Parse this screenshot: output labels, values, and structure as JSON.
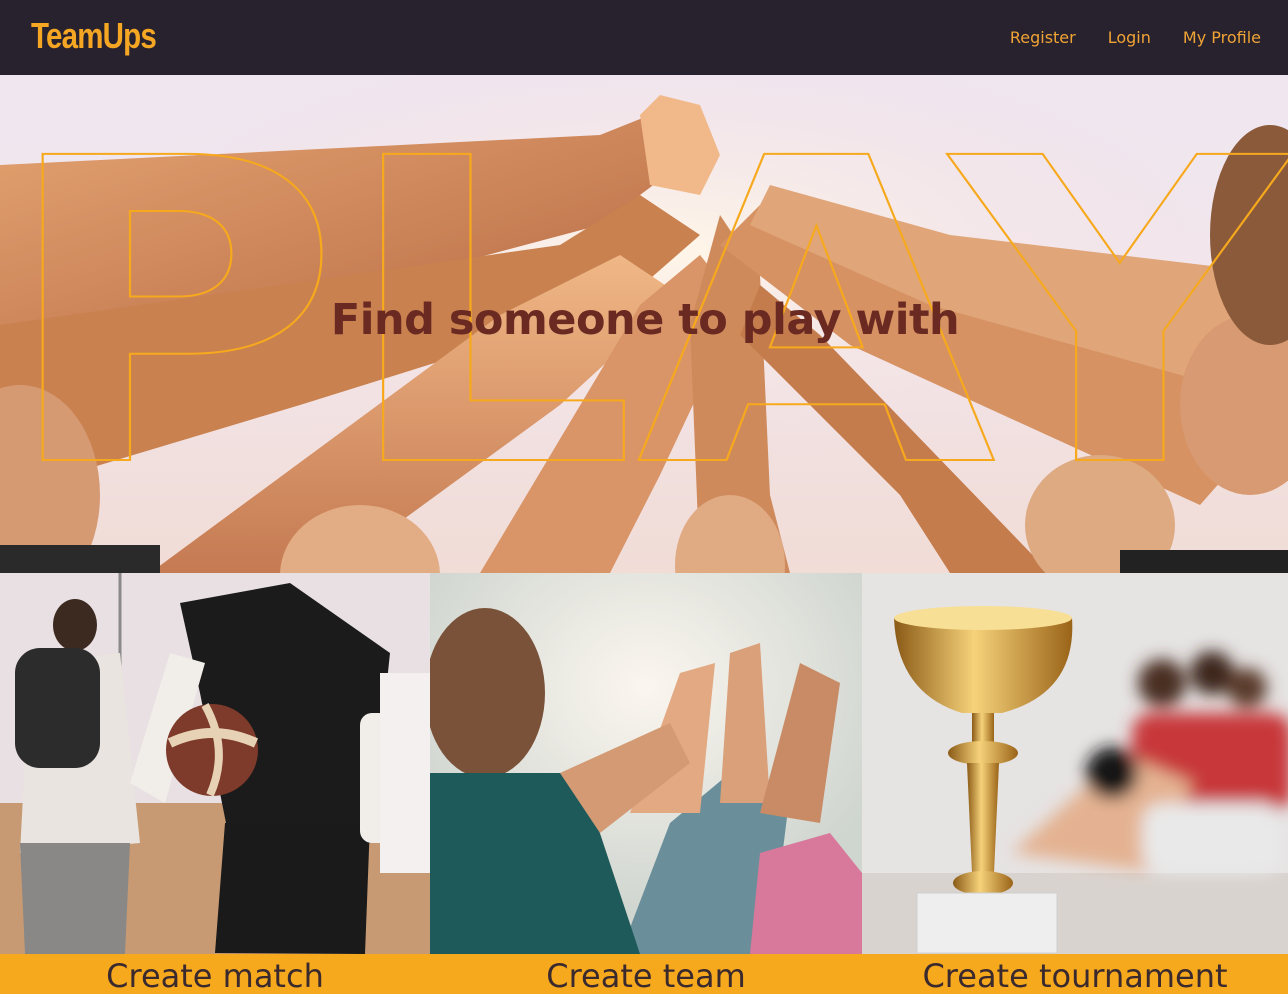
{
  "brand": {
    "name": "TeamUps",
    "color": "#f5a623"
  },
  "nav": {
    "items": [
      {
        "label": "Register"
      },
      {
        "label": "Login"
      },
      {
        "label": "My Profile"
      }
    ]
  },
  "hero": {
    "background_word": "PLAY",
    "title": "Find someone to play with",
    "photo": "group-high-five-photo"
  },
  "cards": [
    {
      "label": "Create match",
      "photo": "basketball-players-photo"
    },
    {
      "label": "Create team",
      "photo": "team-high-five-photo"
    },
    {
      "label": "Create tournament",
      "photo": "trophy-cup-photo"
    }
  ],
  "colors": {
    "navbar_bg": "#28222f",
    "accent": "#f7a91d",
    "hero_title": "#6a2a22"
  }
}
